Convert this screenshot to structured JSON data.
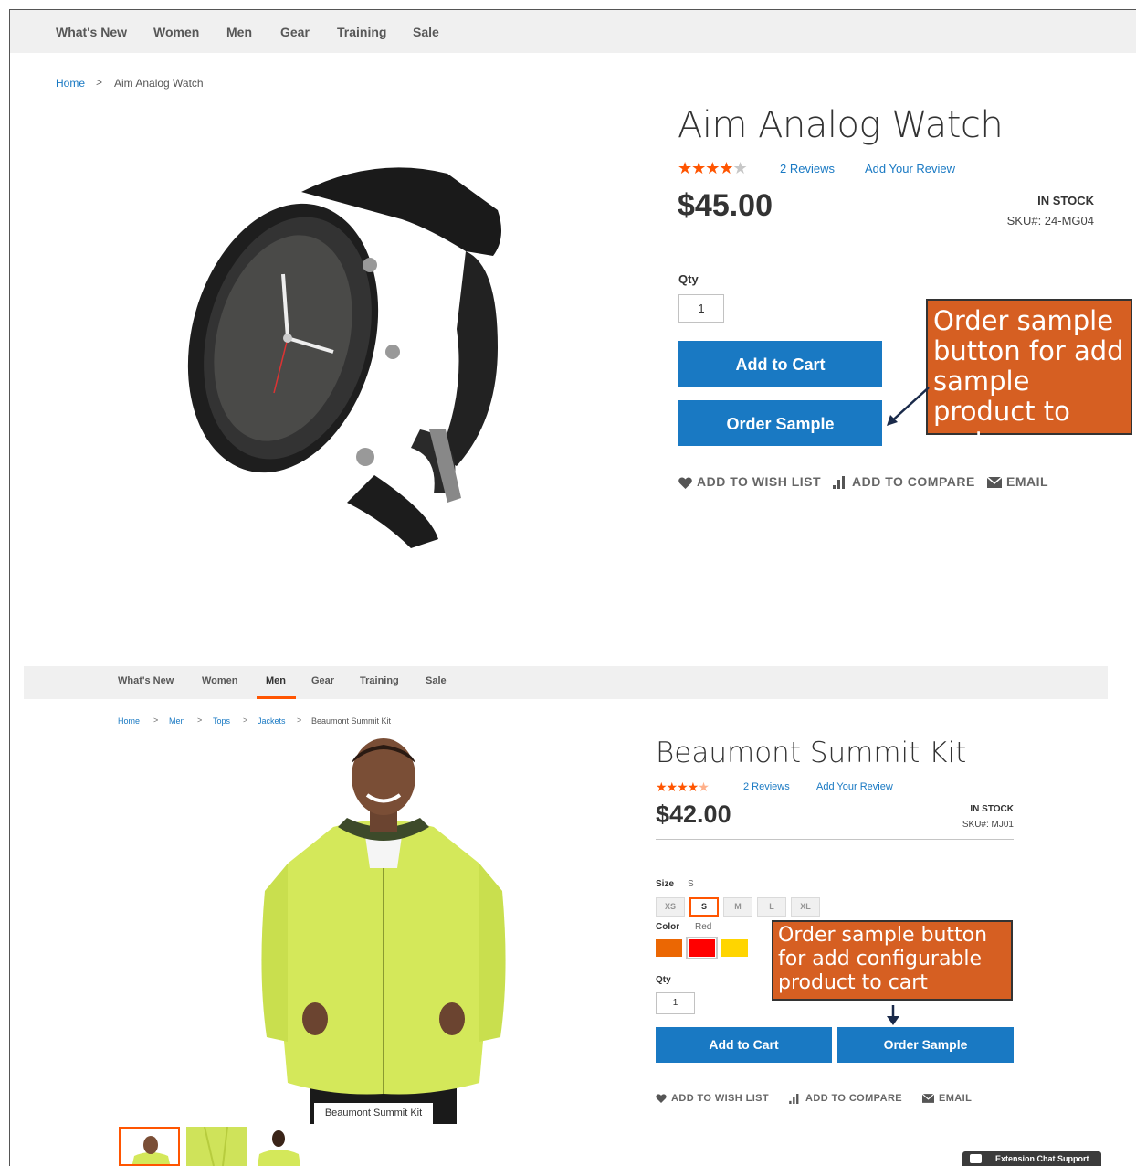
{
  "section1": {
    "nav": [
      {
        "label": "What's New"
      },
      {
        "label": "Women"
      },
      {
        "label": "Men"
      },
      {
        "label": "Gear"
      },
      {
        "label": "Training"
      },
      {
        "label": "Sale"
      }
    ],
    "breadcrumb": {
      "home": "Home",
      "sep": ">",
      "current": "Aim Analog Watch"
    },
    "product": {
      "title": "Aim Analog Watch",
      "rating_stars": 4,
      "rating_max": 5,
      "reviews": "2  Reviews",
      "add_review": "Add Your Review",
      "price": "$45.00",
      "stock": "IN STOCK",
      "sku": "SKU#:  24-MG04",
      "qty_label": "Qty",
      "qty_value": "1",
      "add_to_cart": "Add to Cart",
      "order_sample": "Order Sample",
      "wishlist": "ADD TO WISH LIST",
      "compare": "ADD TO COMPARE",
      "email": "EMAIL"
    },
    "callout": "Order sample button for add sample product to cart"
  },
  "section2": {
    "nav": [
      {
        "label": "What's New"
      },
      {
        "label": "Women"
      },
      {
        "label": "Men"
      },
      {
        "label": "Gear"
      },
      {
        "label": "Training"
      },
      {
        "label": "Sale"
      }
    ],
    "active_nav": "Men",
    "breadcrumb": {
      "items": [
        "Home",
        "Men",
        "Tops",
        "Jackets"
      ],
      "sep": ">",
      "current": "Beaumont Summit Kit"
    },
    "product": {
      "title": "Beaumont Summit Kit",
      "rating_stars": 4.5,
      "rating_max": 5,
      "reviews": "2  Reviews",
      "add_review": "Add Your Review",
      "price": "$42.00",
      "stock": "IN STOCK",
      "sku": "SKU#:  MJ01",
      "size_label": "Size",
      "size_value": "S",
      "sizes": [
        "XS",
        "S",
        "M",
        "L",
        "XL"
      ],
      "selected_size": "S",
      "color_label": "Color",
      "color_value": "Red",
      "colors": [
        {
          "name": "Orange",
          "hex": "#eb6703"
        },
        {
          "name": "Red",
          "hex": "#ff0000"
        },
        {
          "name": "Yellow",
          "hex": "#ffd500"
        }
      ],
      "qty_label": "Qty",
      "qty_value": "1",
      "add_to_cart": "Add to Cart",
      "order_sample": "Order Sample",
      "wishlist": "ADD TO WISH LIST",
      "compare": "ADD TO COMPARE",
      "email": "EMAIL",
      "image_caption": "Beaumont Summit Kit"
    },
    "callout": "Order sample button for add configurable product to cart",
    "chat": "Extension Chat Support"
  },
  "colors": {
    "primary": "#1979c3",
    "accent": "#ff5501",
    "callout": "#d65f22",
    "nav_bg": "#f0f0f0"
  }
}
